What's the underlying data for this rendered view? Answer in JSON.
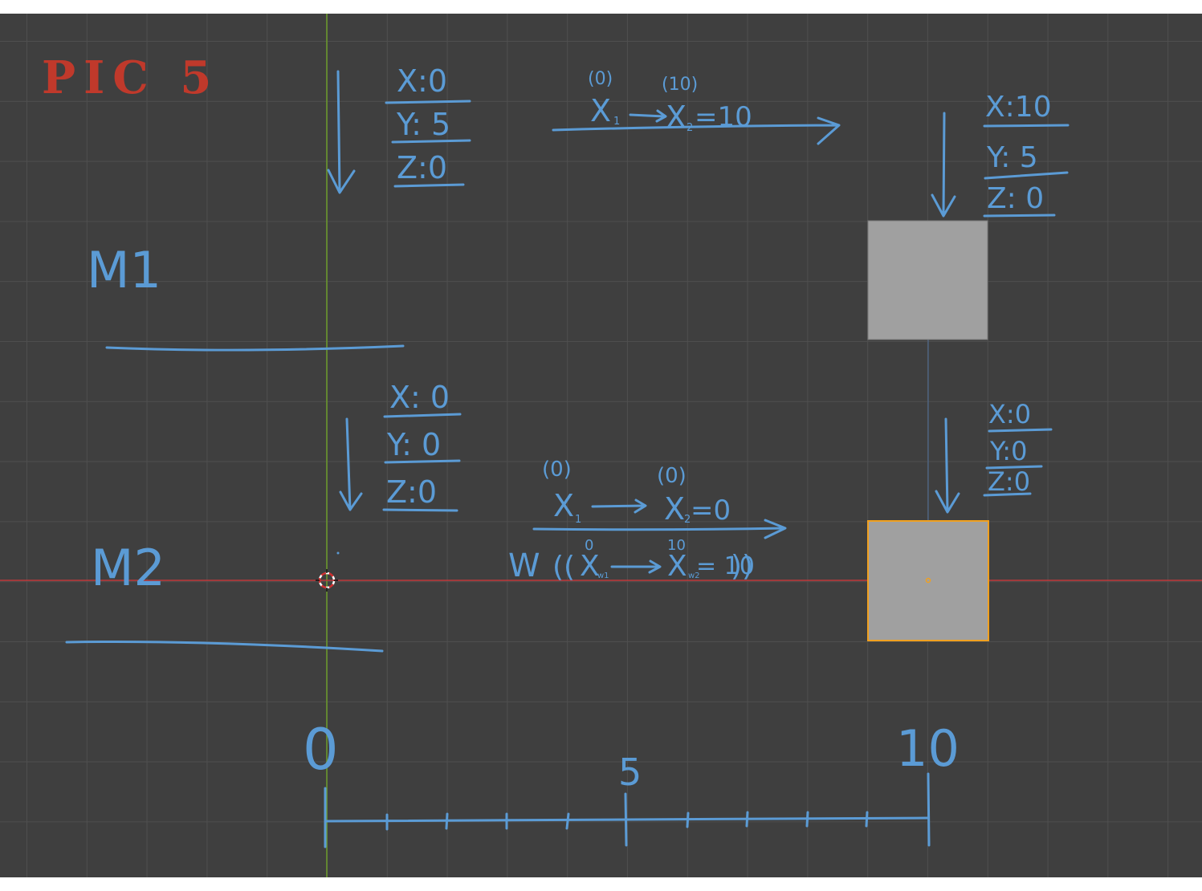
{
  "title": "PIC 5",
  "colors": {
    "viewport_bg": "#3f3f3f",
    "grid": "#4f4f4f",
    "title_red": "#c0392b",
    "ink_blue": "#5b9bd5",
    "x_axis_red": "#c0393b",
    "y_axis_green": "#6b9b2a",
    "cube_gray": "#a0a0a0",
    "selection_orange": "#f0a020"
  },
  "m1": {
    "label": "M1",
    "start": {
      "x": "X:0",
      "y": "Y: 5",
      "z": "Z:0"
    },
    "end": {
      "x": "X:10",
      "y": "Y: 5",
      "z": "Z: 0"
    },
    "note": {
      "x1_sup": "(0)",
      "x1": "X",
      "x1_sub": "1",
      "x2_sup": "(10)",
      "x2": "X",
      "x2_sub": "2",
      "x2_value": "=10"
    }
  },
  "m2": {
    "label": "M2",
    "start": {
      "x": "X: 0",
      "y": "Y: 0",
      "z": "Z:0"
    },
    "end": {
      "x": "X:0",
      "y": "Y:0",
      "z": "Z:0"
    },
    "note": {
      "x1_sup": "(0)",
      "x1": "X",
      "x1_sub": "1",
      "x2_sup": "(0)",
      "x2": "X",
      "x2_sub": "2",
      "x2_value": "=0",
      "w": "W",
      "w_open": "((",
      "wx1_sup": "0",
      "wx1": "X",
      "wx1_sub": "w1",
      "wx2_sup": "10",
      "wx2": "X",
      "wx2_sub": "w2",
      "wx2_value": "= 10",
      "w_close": "))"
    }
  },
  "scale": {
    "label_start": "0",
    "label_mid": "5",
    "label_end": "10"
  },
  "icons": {
    "origin": "3d-cursor-icon",
    "cube_origin": "object-origin-dot-icon"
  }
}
